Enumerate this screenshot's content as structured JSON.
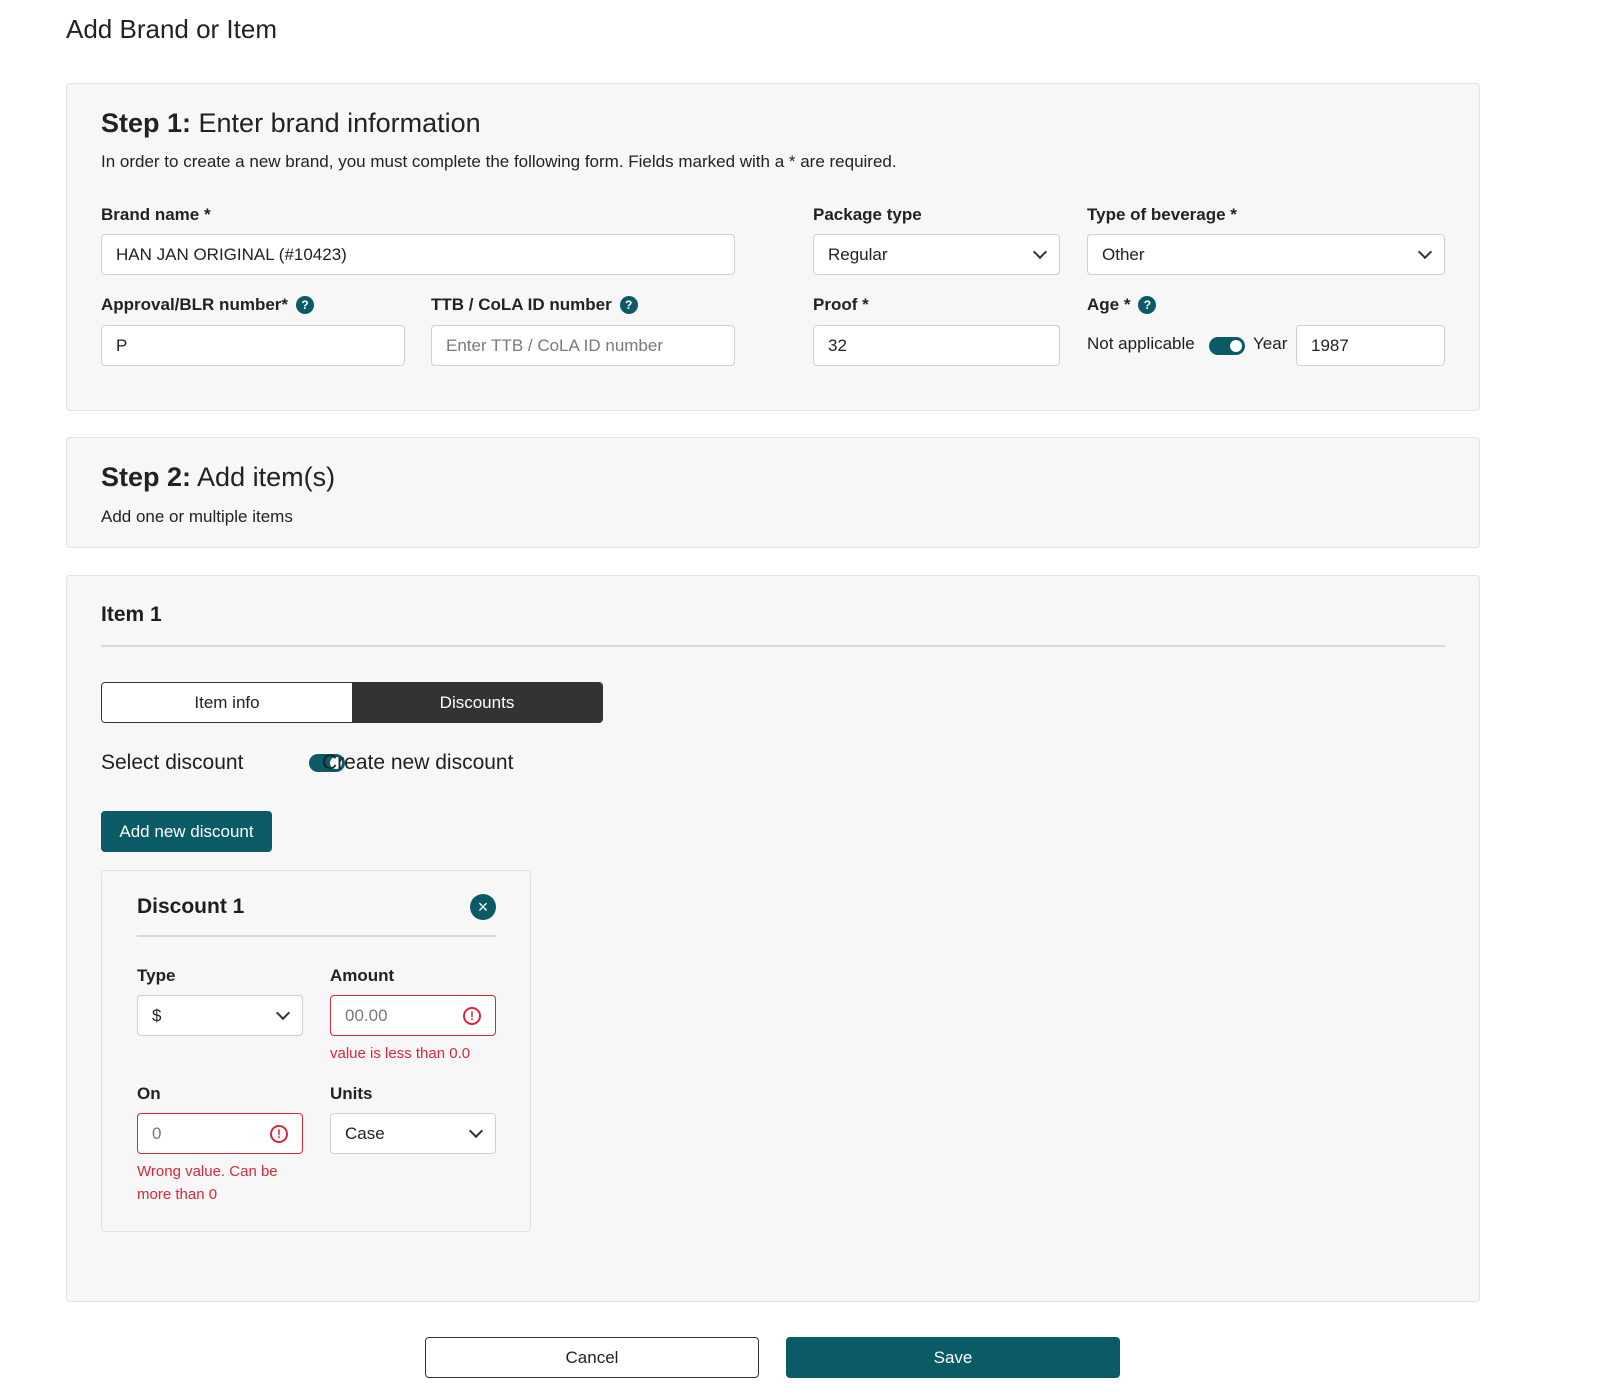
{
  "page": {
    "title": "Add Brand or Item"
  },
  "step1": {
    "title_bold": "Step 1:",
    "title_rest": " Enter brand information",
    "description": "In order to create a new brand, you must complete the following form. Fields marked with a * are required.",
    "brand_name": {
      "label": "Brand name *",
      "value": "HAN JAN ORIGINAL (#10423)"
    },
    "package_type": {
      "label": "Package type",
      "value": "Regular"
    },
    "beverage_type": {
      "label": "Type of beverage *",
      "value": "Other"
    },
    "approval": {
      "label": "Approval/BLR number*",
      "value": "P"
    },
    "ttb": {
      "label": "TTB / CoLA ID number",
      "placeholder": "Enter TTB / CoLA ID number"
    },
    "proof": {
      "label": "Proof *",
      "value": "32"
    },
    "age": {
      "label": "Age *",
      "not_applicable": "Not applicable",
      "year_label": "Year",
      "year_value": "1987"
    }
  },
  "step2": {
    "title_bold": "Step 2:",
    "title_rest": " Add item(s)",
    "description": "Add one or multiple items"
  },
  "item": {
    "title": "Item 1",
    "tabs": [
      {
        "label": "Item info",
        "active": false
      },
      {
        "label": "Discounts",
        "active": true
      }
    ],
    "select_discount": "Select discount",
    "create_new_discount": "Create new discount",
    "add_discount_button": "Add new discount",
    "discount": {
      "title": "Discount 1",
      "type": {
        "label": "Type",
        "value": "$"
      },
      "amount": {
        "label": "Amount",
        "placeholder": "00.00",
        "error": "value is less than 0.0"
      },
      "on": {
        "label": "On",
        "placeholder": "0",
        "error_line1": "Wrong value. Can be",
        "error_line2": "more than 0"
      },
      "units": {
        "label": "Units",
        "value": "Case"
      }
    }
  },
  "footer": {
    "cancel": "Cancel",
    "save": "Save"
  },
  "colors": {
    "accent": "#0b5b66",
    "error": "#d6283b",
    "dark_tab": "#333333"
  },
  "icons": {
    "help": "question-circle-icon",
    "chevron": "chevron-down-icon",
    "error": "exclamation-circle-icon",
    "close": "close-icon"
  }
}
